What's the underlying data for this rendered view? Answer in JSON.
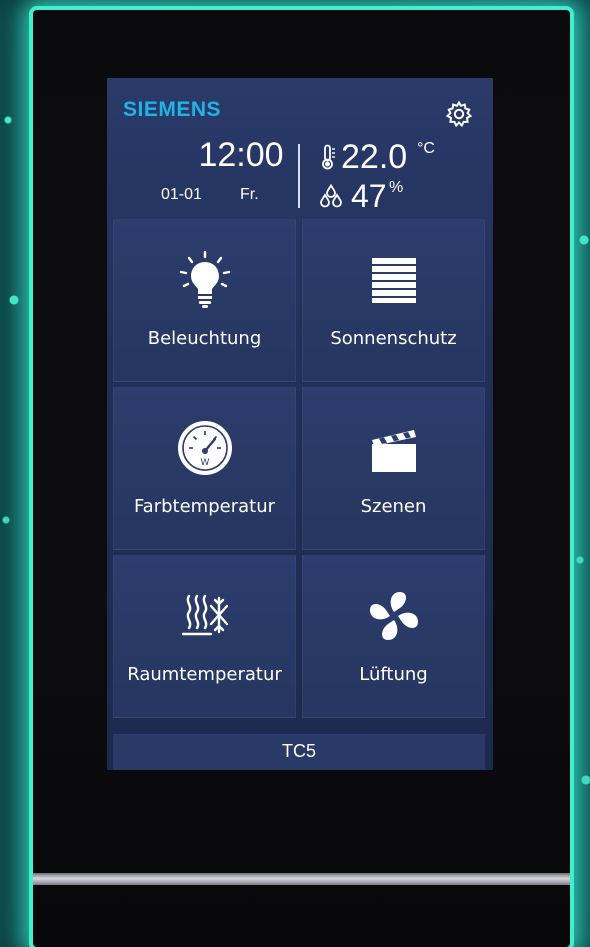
{
  "header": {
    "brand": "SIEMENS",
    "time": "12:00",
    "date": "01-01",
    "weekday": "Fr.",
    "temperature": "22.0",
    "temperature_unit": "°C",
    "humidity": "47",
    "humidity_unit": "%"
  },
  "tiles": [
    {
      "label": "Beleuchtung",
      "icon": "lightbulb-icon"
    },
    {
      "label": "Sonnenschutz",
      "icon": "blinds-icon"
    },
    {
      "label": "Farbtemperatur",
      "icon": "gauge-icon"
    },
    {
      "label": "Szenen",
      "icon": "clapperboard-icon"
    },
    {
      "label": "Raumtemperatur",
      "icon": "heat-cool-icon"
    },
    {
      "label": "Lüftung",
      "icon": "fan-icon"
    }
  ],
  "footer": {
    "label": "TC5"
  },
  "colors": {
    "brand": "#1fb4e6",
    "screen_bg": "#213058",
    "tile_bg": "#2c3d6e",
    "glow": "#3ff0cf"
  }
}
